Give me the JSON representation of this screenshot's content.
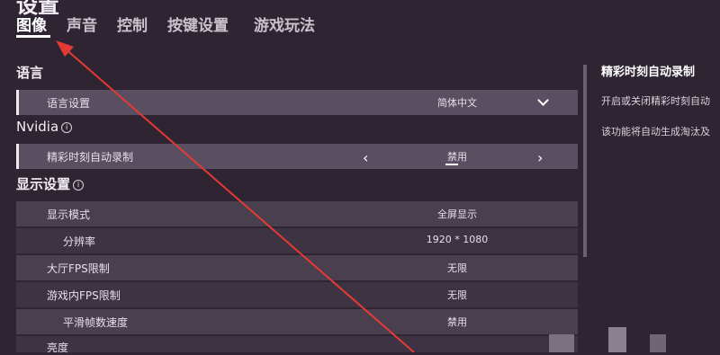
{
  "page_title_partial": "设置",
  "tabs": [
    {
      "label": "图像",
      "active": true
    },
    {
      "label": "声音",
      "active": false
    },
    {
      "label": "控制",
      "active": false
    },
    {
      "label": "按键设置",
      "active": false
    },
    {
      "label": "游戏玩法",
      "active": false
    }
  ],
  "sections": {
    "language": "语言",
    "nvidia": "Nvidia",
    "display": "显示设置"
  },
  "info_icon_glyph": "i",
  "rows": {
    "language_setting": {
      "label": "语言设置",
      "value": "简体中文"
    },
    "highlight_record": {
      "label": "精彩时刻自动录制",
      "value": "禁用"
    },
    "display_mode": {
      "label": "显示模式",
      "value": "全屏显示"
    },
    "resolution": {
      "label": "分辨率",
      "value": "1920 * 1080"
    },
    "lobby_fps": {
      "label": "大厅FPS限制",
      "value": "无限"
    },
    "ingame_fps": {
      "label": "游戏内FPS限制",
      "value": "无限"
    },
    "smooth_framerate": {
      "label": "平滑帧数速度",
      "value": "禁用"
    },
    "brightness": {
      "label": "亮度"
    }
  },
  "side_panel": {
    "title": "精彩时刻自动录制",
    "line1": "开启或关闭精彩时刻自动",
    "line2": "该功能将自动生成淘汰及"
  },
  "colors": {
    "background": "#2f2532",
    "row": "#4a3f4f",
    "row_highlight": "#5a4f60",
    "annotation_arrow": "#e53935"
  },
  "icons": [
    "info-icon",
    "chevron-down-icon",
    "arrow-left-icon",
    "arrow-right-icon"
  ]
}
